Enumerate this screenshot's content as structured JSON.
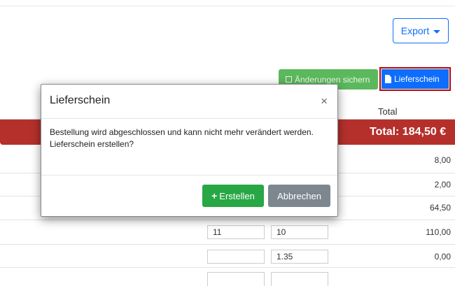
{
  "toolbar": {
    "export_label": "Export",
    "save_label": "Änderungen sichern",
    "delivery_note_label": "Lieferschein"
  },
  "table": {
    "total_header": "Total",
    "grand_total": "Total: 184,50 €",
    "rows": [
      {
        "qty": "",
        "price": "",
        "total": "8,00"
      },
      {
        "qty": "",
        "price": "",
        "total": "2,00"
      },
      {
        "qty": "",
        "price": "",
        "total": "64,50"
      },
      {
        "qty": "11",
        "price": "10",
        "total": "110,00"
      },
      {
        "qty": "",
        "price": "1.35",
        "total": "0,00"
      }
    ]
  },
  "modal": {
    "title": "Lieferschein",
    "close_symbol": "×",
    "message_line1": "Bestellung wird abgeschlossen und kann nicht mehr verändert werden.",
    "message_line2": "Lieferschein erstellen?",
    "create_label": "Erstellen",
    "cancel_label": "Abbrechen"
  },
  "colors": {
    "primary": "#0d6efd",
    "success": "#28a745",
    "danger_bar": "#b5302b",
    "secondary": "#7d8790"
  }
}
